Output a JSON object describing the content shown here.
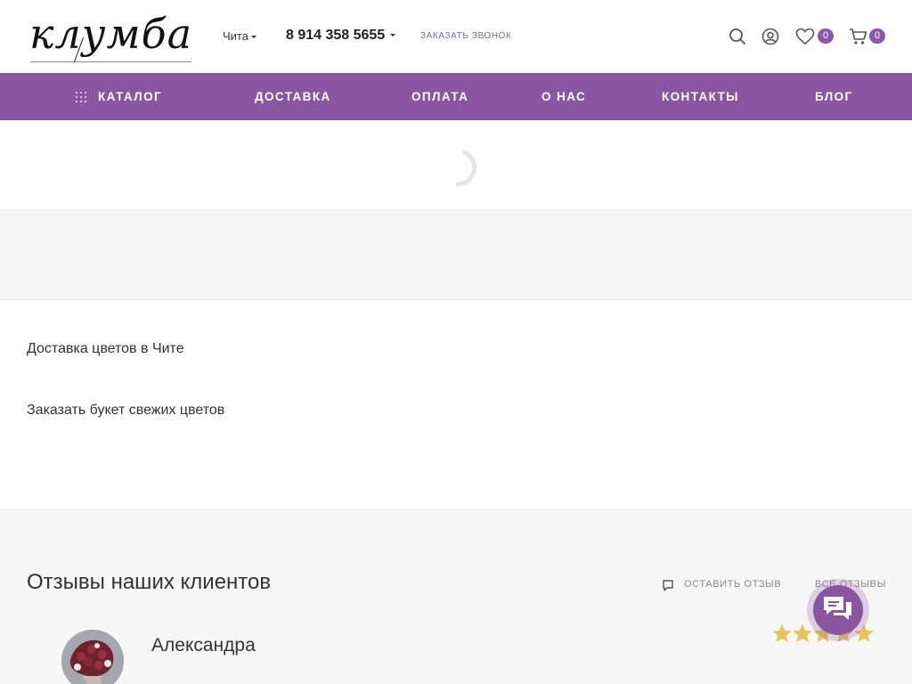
{
  "header": {
    "logo_text": "клумба",
    "city": "Чита",
    "phone": "8 914 358 5655",
    "callback_label": "ЗАКАЗАТЬ ЗВОНОК",
    "favorites_count": "0",
    "cart_count": "0"
  },
  "nav": {
    "items": [
      {
        "label": "КАТАЛОГ"
      },
      {
        "label": "ДОСТАВКА"
      },
      {
        "label": "ОПЛАТА"
      },
      {
        "label": "О НАС"
      },
      {
        "label": "КОНТАКТЫ"
      },
      {
        "label": "БЛОГ"
      }
    ]
  },
  "seo": {
    "line1": "Доставка цветов в Чите",
    "line2": "Заказать букет свежих цветов"
  },
  "reviews": {
    "title": "Отзывы наших клиентов",
    "leave_review_label": "ОСТАВИТЬ ОТЗЫВ",
    "all_reviews_label": "ВСЕ ОТЗЫВЫ",
    "items": [
      {
        "author": "Александра",
        "rating": 5
      }
    ]
  },
  "colors": {
    "accent": "#8b56a1",
    "star": "#e6c35c",
    "band_grey": "#f7f7f7"
  },
  "icons": {
    "search": "search-icon",
    "account": "user-icon",
    "favorites": "heart-icon",
    "cart": "cart-icon",
    "catalog": "grid-icon",
    "review": "comment-icon",
    "chat": "chat-icon"
  }
}
